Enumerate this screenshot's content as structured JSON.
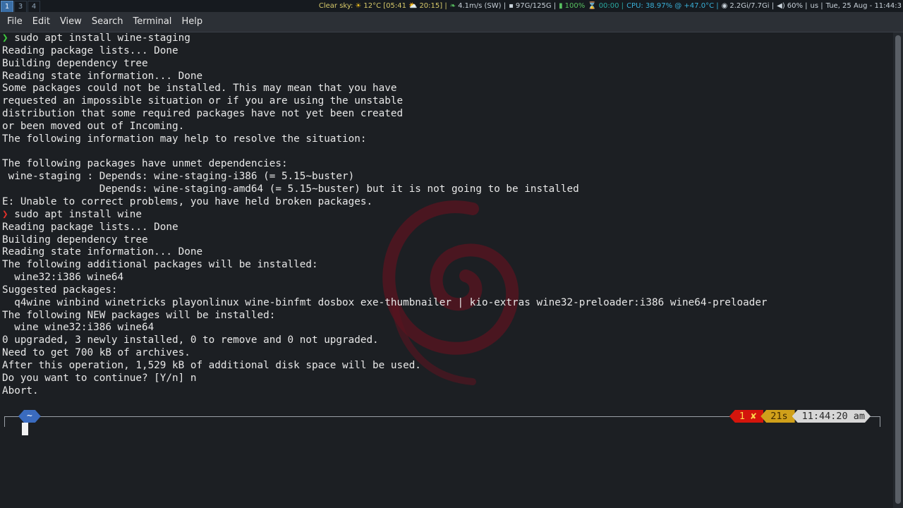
{
  "topbar": {
    "workspaces": [
      "1",
      "3",
      "4"
    ],
    "active_workspace": "1",
    "weather": "Clear sky:",
    "temp": "12°C [05:41",
    "sunset": "20:15] |",
    "wind": "4.1m/s (SW) |",
    "disk": "97G/125G |",
    "battery": "100%",
    "timer": "00:00 |",
    "cpu": "CPU: 38.97% @ +47.0°C |",
    "mem": "2.2Gi/7.7Gi |",
    "volume": "60% |",
    "layout": "us |",
    "datetime": "Tue, 25 Aug - 11:44:3"
  },
  "menubar": {
    "file": "File",
    "edit": "Edit",
    "view": "View",
    "search": "Search",
    "terminal": "Terminal",
    "help": "Help"
  },
  "terminal": {
    "prompt_symbol": "❯",
    "lines": [
      {
        "prompt": "ok",
        "text": "sudo apt install wine-staging"
      },
      {
        "text": "Reading package lists... Done"
      },
      {
        "text": "Building dependency tree"
      },
      {
        "text": "Reading state information... Done"
      },
      {
        "text": "Some packages could not be installed. This may mean that you have"
      },
      {
        "text": "requested an impossible situation or if you are using the unstable"
      },
      {
        "text": "distribution that some required packages have not yet been created"
      },
      {
        "text": "or been moved out of Incoming."
      },
      {
        "text": "The following information may help to resolve the situation:"
      },
      {
        "text": ""
      },
      {
        "text": "The following packages have unmet dependencies:"
      },
      {
        "text": " wine-staging : Depends: wine-staging-i386 (= 5.15~buster)"
      },
      {
        "text": "                Depends: wine-staging-amd64 (= 5.15~buster) but it is not going to be installed"
      },
      {
        "text": "E: Unable to correct problems, you have held broken packages."
      },
      {
        "prompt": "err",
        "text": "sudo apt install wine"
      },
      {
        "text": "Reading package lists... Done"
      },
      {
        "text": "Building dependency tree"
      },
      {
        "text": "Reading state information... Done"
      },
      {
        "text": "The following additional packages will be installed:"
      },
      {
        "text": "  wine32:i386 wine64"
      },
      {
        "text": "Suggested packages:"
      },
      {
        "text": "  q4wine winbind winetricks playonlinux wine-binfmt dosbox exe-thumbnailer | kio-extras wine32-preloader:i386 wine64-preloader"
      },
      {
        "text": "The following NEW packages will be installed:"
      },
      {
        "text": "  wine wine32:i386 wine64"
      },
      {
        "text": "0 upgraded, 3 newly installed, 0 to remove and 0 not upgraded."
      },
      {
        "text": "Need to get 700 kB of archives."
      },
      {
        "text": "After this operation, 1,529 kB of additional disk space will be used."
      },
      {
        "text": "Do you want to continue? [Y/n] n"
      },
      {
        "text": "Abort."
      }
    ]
  },
  "prompt": {
    "dir": "~",
    "exit_status": "1 ✘",
    "duration": "21s",
    "clock": "11:44:20 am"
  },
  "colors": {
    "prompt_ok": "#3ecf3e",
    "prompt_err": "#e0302a",
    "dir_badge": "#3a6bbf",
    "status_red": "#d4150c",
    "duration_yellow": "#d0a01a"
  },
  "icons": {
    "sun": "sun-icon",
    "sunset": "sunset-icon",
    "wind": "leaf-icon",
    "disk": "floppy-icon",
    "battery": "battery-icon",
    "timer": "hourglass-icon",
    "memory": "chip-icon",
    "volume": "speaker-icon"
  }
}
